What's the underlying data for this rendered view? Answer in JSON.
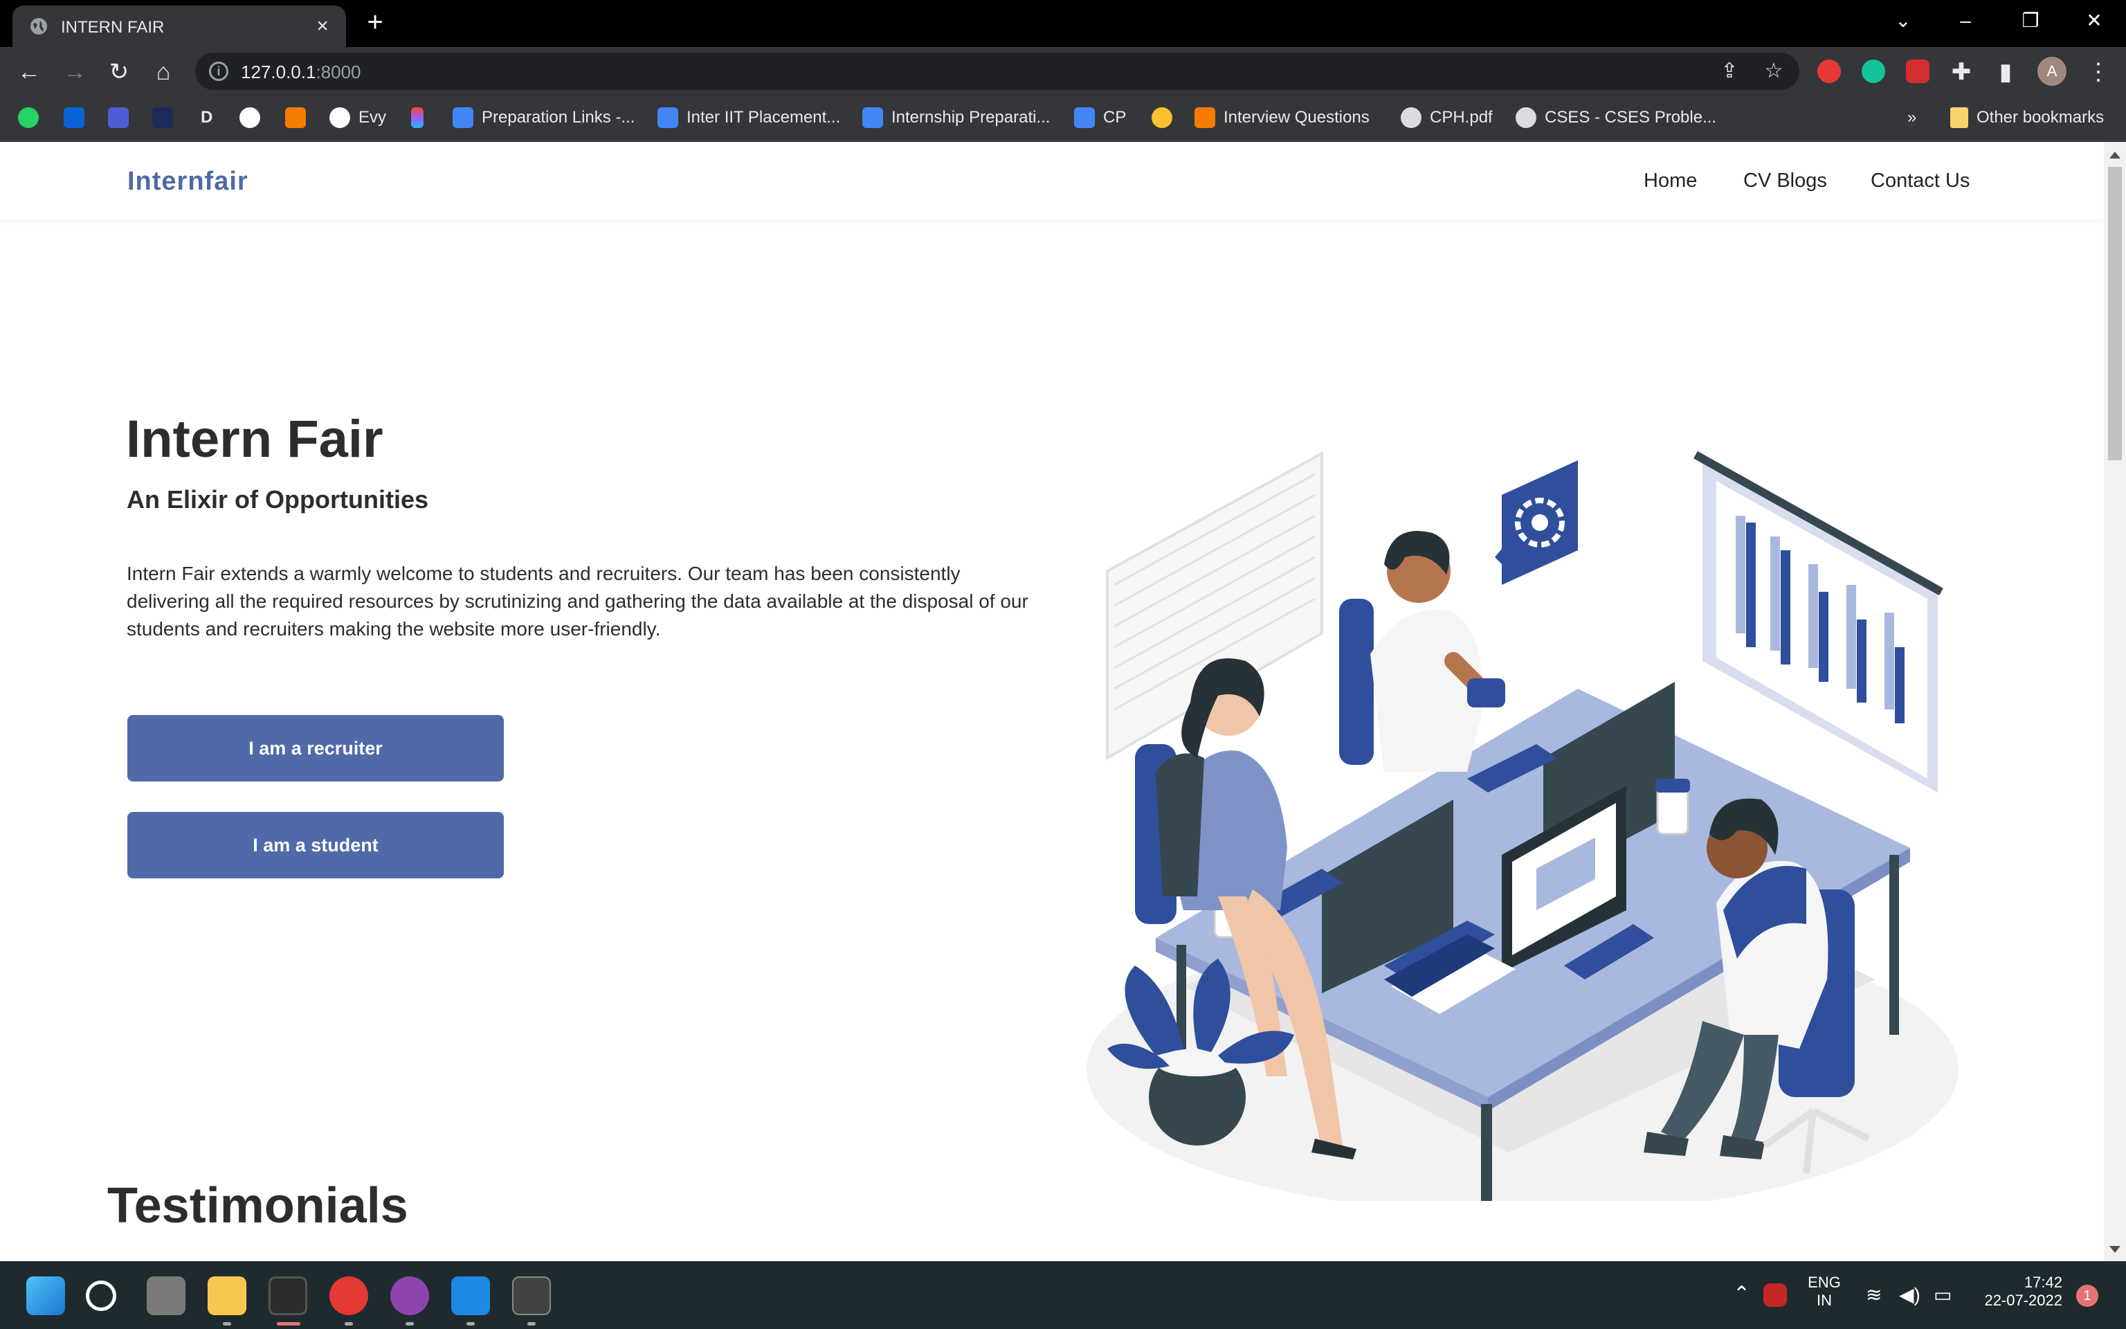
{
  "browser": {
    "tab_title": "INTERN FAIR",
    "url_host": "127.0.0.1",
    "url_port": ":8000",
    "profile_initial": "A"
  },
  "bookmarks": {
    "items": [
      {
        "label": ""
      },
      {
        "label": ""
      },
      {
        "label": ""
      },
      {
        "label": ""
      },
      {
        "label": "D"
      },
      {
        "label": ""
      },
      {
        "label": ""
      },
      {
        "label": "Evy"
      },
      {
        "label": ""
      },
      {
        "label": "Preparation Links -..."
      },
      {
        "label": "Inter IIT Placement..."
      },
      {
        "label": "Internship Preparati..."
      },
      {
        "label": "CP"
      },
      {
        "label": ""
      },
      {
        "label": "Interview Questions"
      },
      {
        "label": "CPH.pdf"
      },
      {
        "label": "CSES - CSES Proble..."
      }
    ],
    "overflow": "»",
    "other": "Other bookmarks"
  },
  "site": {
    "brand": "Internfair",
    "nav": {
      "home": "Home",
      "cv_blogs": "CV Blogs",
      "contact": "Contact Us"
    },
    "hero": {
      "title": "Intern Fair",
      "subtitle": "An Elixir of Opportunities",
      "description": "Intern Fair extends a warmly welcome to students and recruiters. Our team has been consistently delivering all the required resources by scrutinizing and gathering the data available at the disposal of our students and recruiters making the website more user-friendly.",
      "recruiter_button": "I am a recruiter",
      "student_button": "I am a student"
    },
    "testimonials_heading": "Testimonials"
  },
  "taskbar": {
    "lang_top": "ENG",
    "lang_bottom": "IN",
    "time": "17:42",
    "date": "22-07-2022",
    "notifications": "1"
  },
  "colors": {
    "brand": "#4e6aa6",
    "button": "#5069a9",
    "illustration_blue": "#2f4f9c",
    "illustration_light_blue": "#a9b8de"
  }
}
